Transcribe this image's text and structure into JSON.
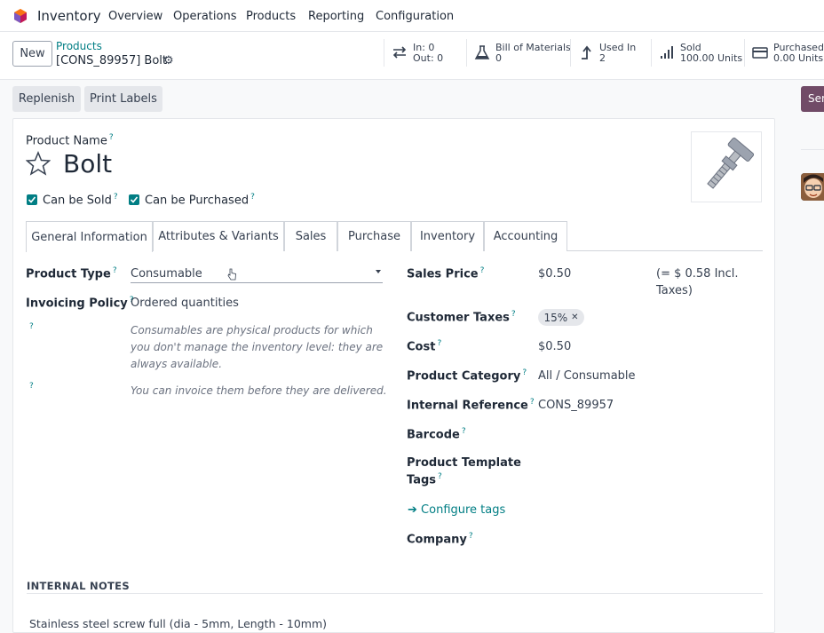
{
  "app": {
    "name": "Inventory",
    "logo_icon": "odoo-inventory-logo"
  },
  "menu": [
    "Overview",
    "Operations",
    "Products",
    "Reporting",
    "Configuration"
  ],
  "control_panel": {
    "new_label": "New",
    "breadcrumb_parent": "Products",
    "breadcrumb_current": "[CONS_89957] Bolt"
  },
  "stat_buttons": [
    {
      "icon": "transfer-arrows-icon",
      "line1": "In: 0",
      "line2": "Out: 0"
    },
    {
      "icon": "flask-icon",
      "line1": "Bill of Materials",
      "line2": "0"
    },
    {
      "icon": "level-up-icon",
      "line1": "Used In",
      "line2": "2"
    },
    {
      "icon": "signal-bars-icon",
      "line1": "Sold",
      "line2": "100.00 Units"
    },
    {
      "icon": "credit-card-icon",
      "line1": "Purchased",
      "line2": "0.00 Units"
    }
  ],
  "actions": {
    "replenish": "Replenish",
    "print_labels": "Print Labels"
  },
  "form": {
    "product_name_label": "Product Name",
    "product_name": "Bolt",
    "can_be_sold_label": "Can be Sold",
    "can_be_sold": true,
    "can_be_purchased_label": "Can be Purchased",
    "can_be_purchased": true,
    "tabs": [
      "General Information",
      "Attributes & Variants",
      "Sales",
      "Purchase",
      "Inventory",
      "Accounting"
    ],
    "active_tab": "General Information",
    "product_type_label": "Product Type",
    "product_type": "Consumable",
    "invoicing_policy_label": "Invoicing Policy",
    "invoicing_policy": "Ordered quantities",
    "consumable_help_1": "Consumables are physical products for which",
    "consumable_help_2": "you don't manage the inventory level: they are",
    "consumable_help_3": "always available.",
    "invoice_help": "You can invoice them before they are delivered.",
    "sales_price_label": "Sales Price",
    "sales_price": "$0.50",
    "incl_taxes_1": "(= $ 0.58 Incl.",
    "incl_taxes_2": "Taxes)",
    "customer_taxes_label": "Customer Taxes",
    "customer_tax_tag": "15%",
    "cost_label": "Cost",
    "cost": "$0.50",
    "product_category_label": "Product Category",
    "product_category": "All / Consumable",
    "internal_reference_label": "Internal Reference",
    "internal_reference": "CONS_89957",
    "barcode_label": "Barcode",
    "template_tags_label_1": "Product Template",
    "template_tags_label_2": "Tags",
    "configure_tags": "Configure tags",
    "company_label": "Company",
    "internal_notes_heading": "INTERNAL NOTES",
    "internal_notes": "Stainless steel screw full (dia - 5mm, Length - 10mm)"
  },
  "chatter": {
    "send_label": "Send"
  },
  "colors": {
    "accent": "#017e84",
    "brand": "#714b67"
  }
}
